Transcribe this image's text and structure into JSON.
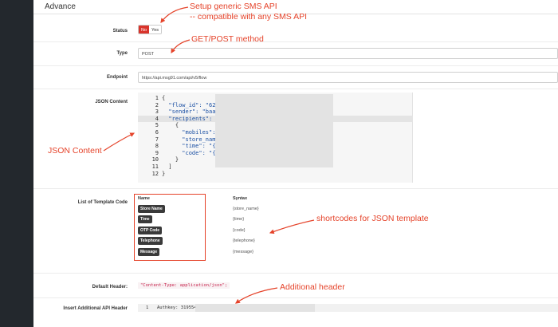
{
  "section": {
    "title": "Advance"
  },
  "status": {
    "label": "Status",
    "options": [
      "No",
      "Yes"
    ],
    "selected": "No"
  },
  "type": {
    "label": "Type",
    "value": "POST"
  },
  "endpoint": {
    "label": "Endpoint",
    "value": "https://api.msg91.com/api/v5/flow"
  },
  "json": {
    "label": "JSON Content",
    "line_numbers": [
      "1",
      "2",
      "3",
      "4",
      "5",
      "6",
      "7",
      "8",
      "9",
      "10",
      "11",
      "12"
    ],
    "lines": [
      "{",
      "  \"flow_id\": \"627",
      "  \"sender\": \"baap",
      "  \"recipients\": [",
      "    {",
      "      \"mobiles\": '",
      "      \"store_name\"",
      "      \"time\": \"{ti",
      "      \"code\": \"{cc",
      "    }",
      "  ]",
      "}"
    ]
  },
  "templates": {
    "label": "List of Template Code",
    "col_name": "Name",
    "col_syntax": "Syntax",
    "rows": [
      {
        "name": "Store Name",
        "syntax": "{store_name}"
      },
      {
        "name": "Time",
        "syntax": "{time}"
      },
      {
        "name": "OTP Code",
        "syntax": "{code}"
      },
      {
        "name": "Telephone",
        "syntax": "{telephone}"
      },
      {
        "name": "Message",
        "syntax": "{message}"
      }
    ]
  },
  "default_header": {
    "label": "Default Header:",
    "value": "\"Content-Type: application/json\";"
  },
  "additional_header": {
    "label": "Insert Additional API Header",
    "line": "1",
    "value": "Authkey: 319554A"
  },
  "annotations": {
    "sms_api_line1": "Setup generic SMS API",
    "sms_api_line2": "-- compatible with any SMS API",
    "method": "GET/POST method",
    "json": "JSON Content",
    "shortcodes": "shortcodes for JSON template",
    "additional": "Additional header"
  },
  "colors": {
    "accent": "#e5432a",
    "toggle_active": "#d9342b",
    "sidebar": "#23282d"
  }
}
